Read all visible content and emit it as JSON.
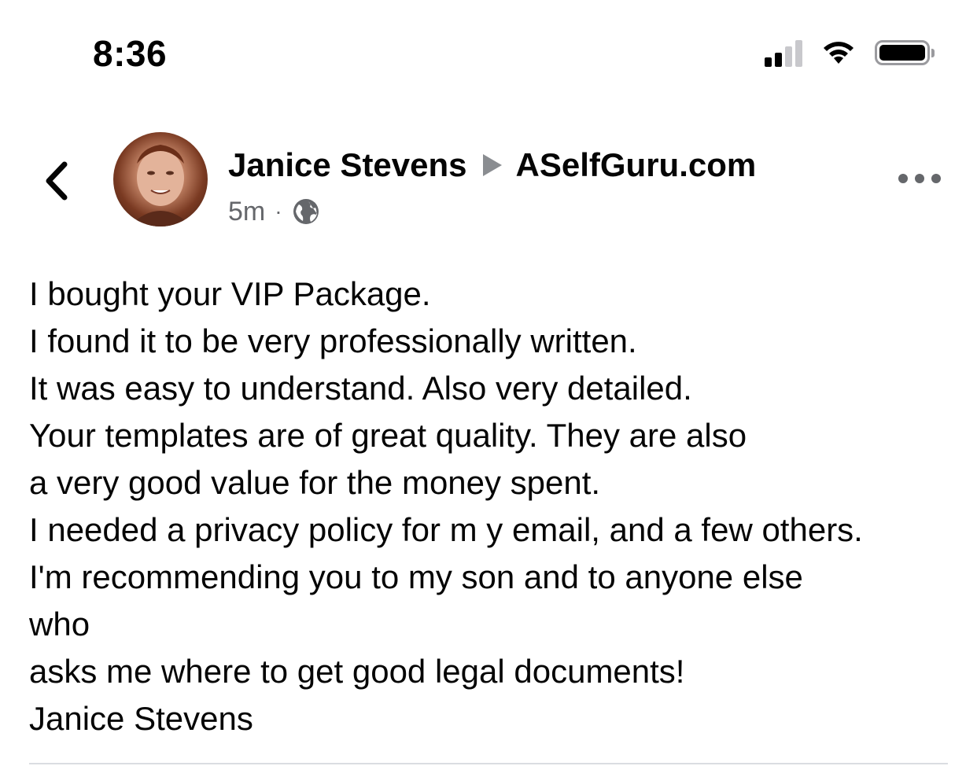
{
  "status_bar": {
    "time": "8:36",
    "signal_icon": "cellular-signal-icon",
    "wifi_icon": "wifi-icon",
    "battery_icon": "battery-icon",
    "battery_level": 1.0
  },
  "header": {
    "back_icon": "chevron-left-icon",
    "avatar_alt": "Janice Stevens profile photo",
    "author": "Janice Stevens",
    "target_page": "ASelfGuru.com",
    "timestamp": "5m",
    "separator": "·",
    "privacy_icon": "globe-icon",
    "more_icon": "more-horizontal-icon"
  },
  "post": {
    "lines": [
      "I bought your VIP Package.",
      "I found it to be very professionally written.",
      "It was easy to understand. Also very detailed.",
      "Your templates are of great quality. They are also",
      "a very good value for the money spent.",
      "I needed a privacy policy for m y email, and a few others.",
      "I'm recommending you to my son and to anyone else",
      "who",
      "asks me where to get good legal documents!",
      "Janice Stevens"
    ]
  },
  "colors": {
    "text_primary": "#050505",
    "text_secondary": "#65676b",
    "arrow_gray": "#8a8d91",
    "divider": "#dadde1"
  }
}
